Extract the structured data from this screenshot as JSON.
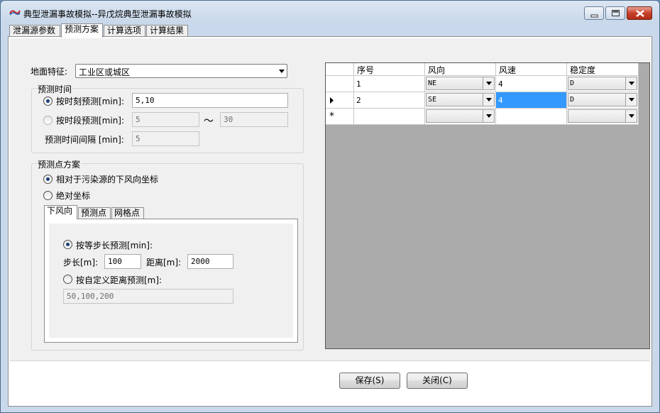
{
  "window": {
    "title": "典型泄漏事故模拟--异戊烷典型泄漏事故模拟"
  },
  "tabs": [
    {
      "label": "泄漏源参数"
    },
    {
      "label": "预测方案"
    },
    {
      "label": "计算选项"
    },
    {
      "label": "计算结果"
    }
  ],
  "terrain": {
    "label": "地面特征:",
    "value": "工业区或城区"
  },
  "time_group": {
    "title": "预测时间",
    "opt_moment": "按时刻预测[min]:",
    "moment_value": "5,10",
    "opt_period": "按时段预测[min]:",
    "period_from": "5",
    "tilde": "～",
    "period_to": "30",
    "interval_label": "预测时间间隔 [min]:",
    "interval_value": "5"
  },
  "point_group": {
    "title": "预测点方案",
    "opt_relative": "相对于污染源的下风向坐标",
    "opt_absolute": "绝对坐标",
    "subtabs": [
      {
        "label": "下风向"
      },
      {
        "label": "预测点"
      },
      {
        "label": "网格点"
      }
    ],
    "opt_step": "按等步长预测[min]:",
    "step_label": "步长[m]:",
    "step_value": "100",
    "dist_label": "距离[m]:",
    "dist_value": "2000",
    "opt_custom": "按自定义距离预测[m]:",
    "custom_value": "50,100,200"
  },
  "grid": {
    "headers": [
      "序号",
      "风向",
      "风速",
      "稳定度"
    ],
    "rows": [
      {
        "no": "1",
        "dir": "NE",
        "speed": "4",
        "stab": "D"
      },
      {
        "no": "2",
        "dir": "SE",
        "speed": "4",
        "stab": "D"
      }
    ],
    "new_row_marker": "*"
  },
  "buttons": {
    "save": "保存(S)",
    "close": "关闭(C)"
  }
}
